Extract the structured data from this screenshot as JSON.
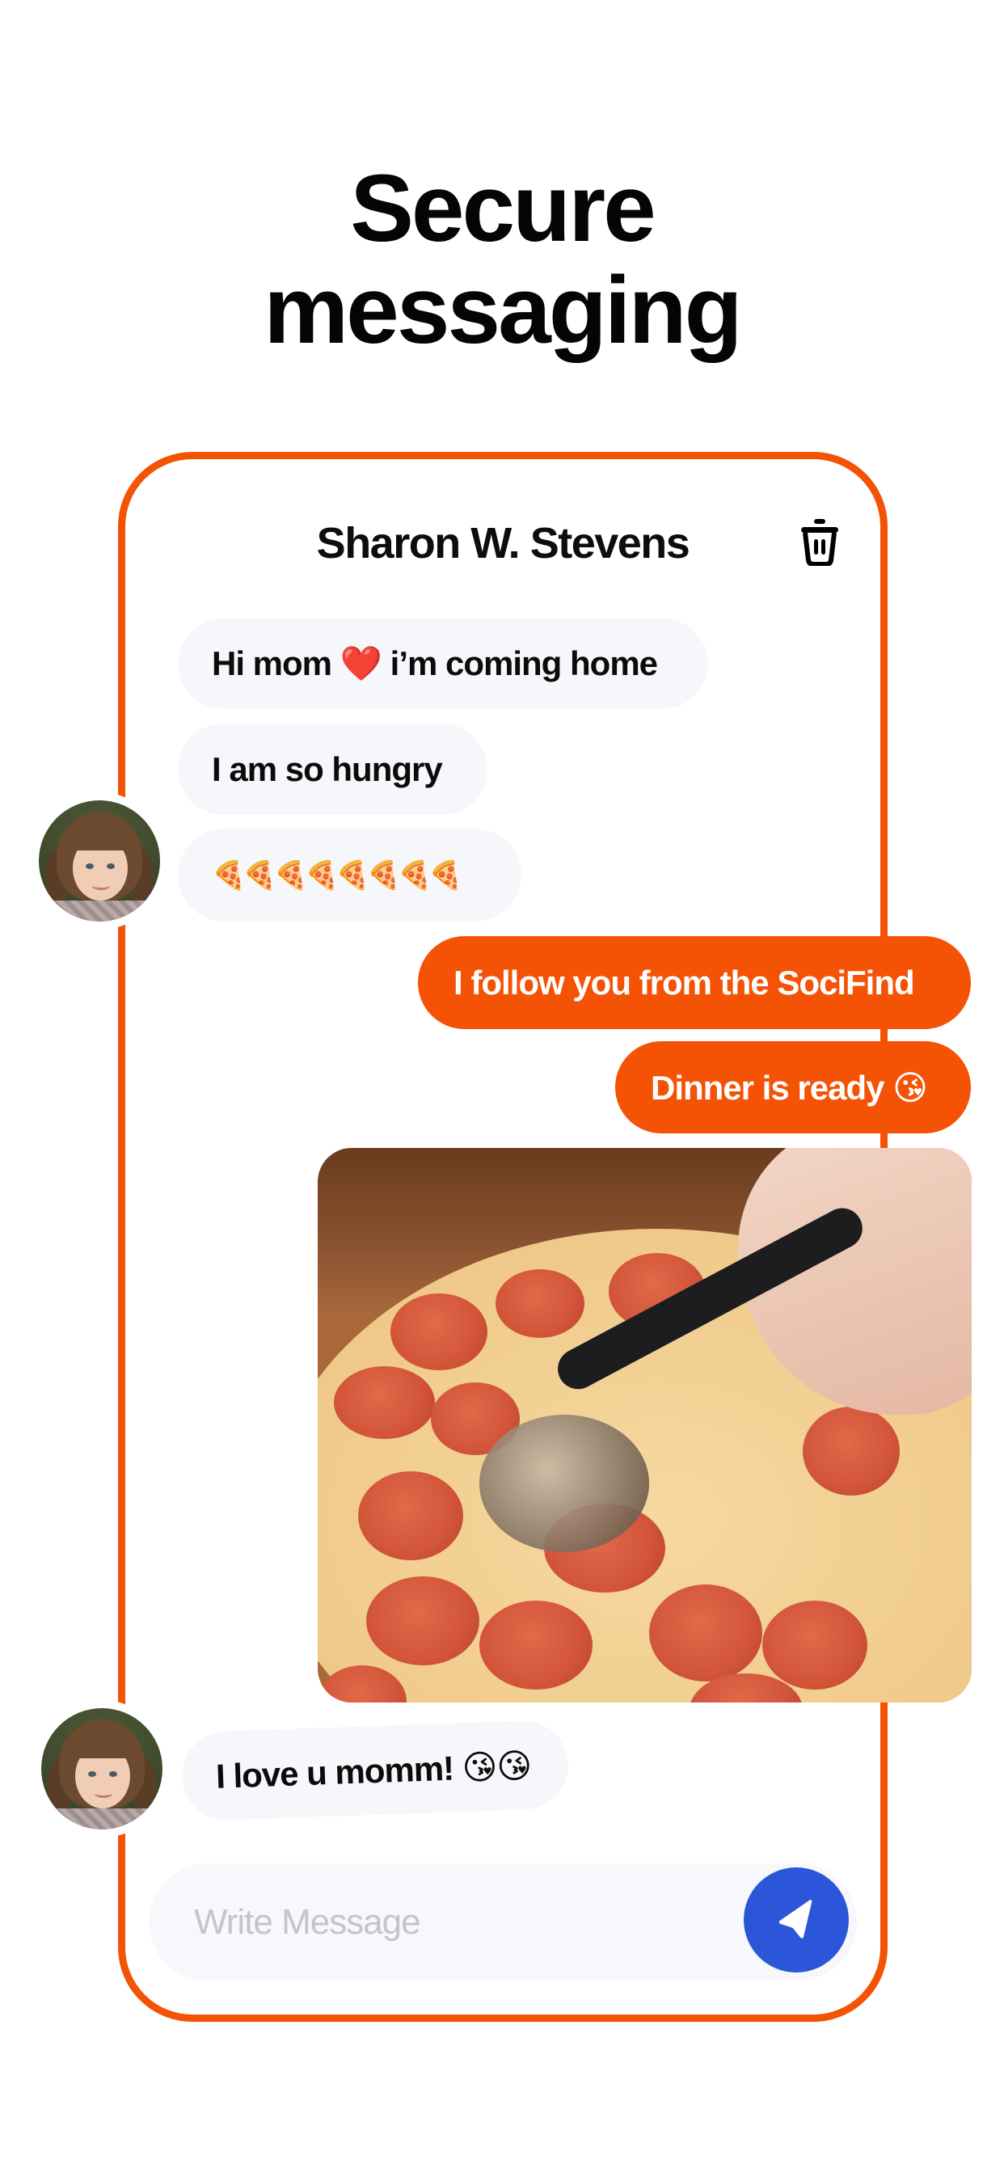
{
  "headline": {
    "line1": "Secure",
    "line2": "messaging"
  },
  "conversation": {
    "contact_name": "Sharon W. Stevens",
    "delete_icon": "trash-icon"
  },
  "messages": [
    {
      "direction": "incoming",
      "text": "Hi mom ❤️ i’m coming home"
    },
    {
      "direction": "incoming",
      "text": "I am so hungry"
    },
    {
      "direction": "incoming",
      "text": "🍕🍕🍕🍕🍕🍕🍕🍕"
    },
    {
      "direction": "outgoing",
      "text": "I follow you from the SociFind"
    },
    {
      "direction": "outgoing",
      "text": "Dinner is ready 😘"
    },
    {
      "direction": "outgoing",
      "type": "image",
      "alt": "pepperoni pizza being cut with a pizza cutter"
    },
    {
      "direction": "incoming",
      "text": "I love u momm! 😘😘"
    }
  ],
  "composer": {
    "placeholder": "Write Message",
    "value": "",
    "send_icon": "send-icon"
  },
  "colors": {
    "accent": "#F45205",
    "send_button": "#2B56DA",
    "incoming_bubble": "#F6F7FB",
    "placeholder": "#C4C5CA"
  }
}
